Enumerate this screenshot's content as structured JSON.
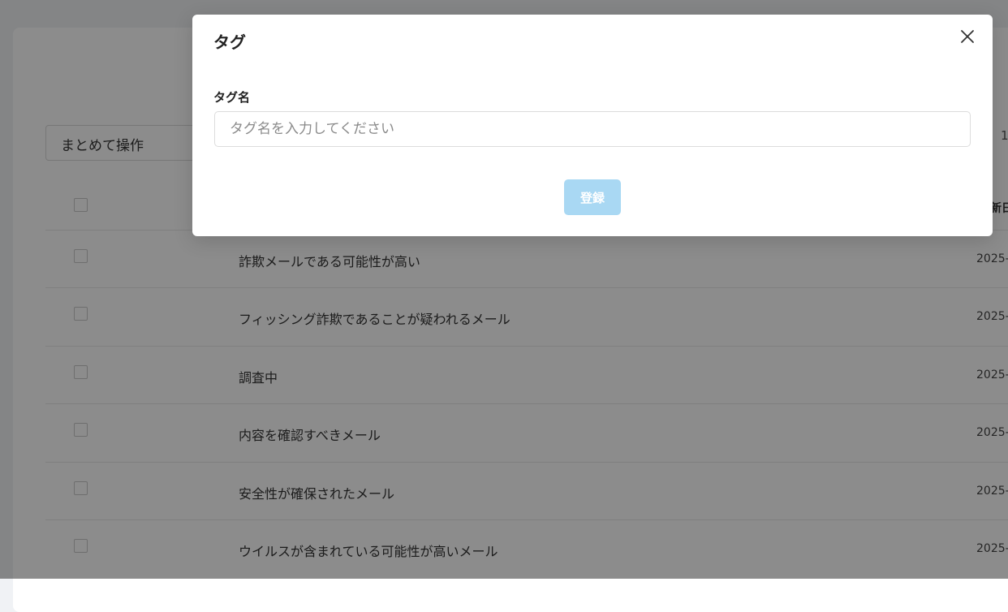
{
  "background": {
    "bulk_action_label": "まとめて操作",
    "pager_text": "1",
    "header_label": "新日",
    "rows": [
      {
        "name": "詐欺メールである可能性が高い",
        "date": "2025-"
      },
      {
        "name": "フィッシング詐欺であることが疑われるメール",
        "date": "2025-"
      },
      {
        "name": "調査中",
        "date": "2025-"
      },
      {
        "name": "内容を確認すべきメール",
        "date": "2025-"
      },
      {
        "name": "安全性が確保されたメール",
        "date": "2025-"
      },
      {
        "name": "ウイルスが含まれている可能性が高いメール",
        "date": "2025-"
      }
    ]
  },
  "modal": {
    "title": "タグ",
    "field_label": "タグ名",
    "input_value": "",
    "input_placeholder": "タグ名を入力してください",
    "submit_label": "登録",
    "submit_disabled": true
  },
  "colors": {
    "overlay": "rgba(0,0,0,0.45)",
    "submit_disabled_bg": "#a9d8f3"
  },
  "icons": {
    "close": "close-icon"
  }
}
